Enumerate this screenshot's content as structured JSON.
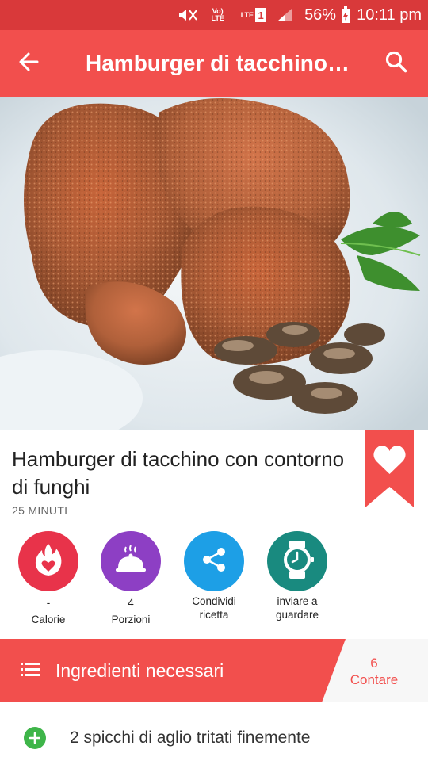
{
  "status_bar": {
    "volte": "Vo) LTE",
    "lte": "LTE",
    "sim": "1",
    "battery_pct": "56%",
    "time": "10:11 pm"
  },
  "app_bar": {
    "title": "Hamburger di tacchino…",
    "back_icon": "arrow-back-icon",
    "search_icon": "search-icon"
  },
  "recipe": {
    "title": "Hamburger di tacchino con contorno di funghi",
    "time": "25 MINUTI",
    "bookmark_icon": "heart-icon"
  },
  "actions": [
    {
      "value": "-",
      "label": "Calorie",
      "icon": "flame-heart-icon",
      "color": "#e8334a"
    },
    {
      "value": "4",
      "label": "Porzioni",
      "icon": "serving-dish-icon",
      "color": "#8d3fc4"
    },
    {
      "value": "Condividi",
      "label": "ricetta",
      "icon": "share-icon",
      "color": "#1d9fe6"
    },
    {
      "value": "inviare a",
      "label": "guardare",
      "icon": "watch-icon",
      "color": "#198a7f"
    }
  ],
  "ingredients_header": {
    "title": "Ingredienti necessari",
    "count": "6",
    "count_label": "Contare"
  },
  "ingredients": [
    {
      "text": "2 spicchi di aglio tritati finemente"
    }
  ],
  "colors": {
    "accent": "#f24f4d",
    "status_bar": "#d9393a",
    "add_green": "#3eb549"
  }
}
